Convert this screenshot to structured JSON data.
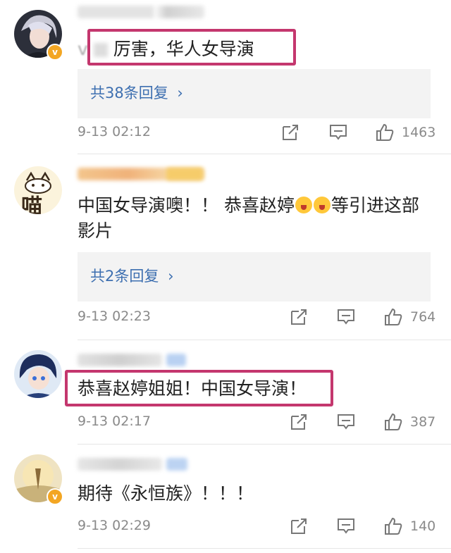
{
  "comments": [
    {
      "text": "厉害，华人女导演",
      "prefix": "v",
      "reply_label": "共38条回复",
      "time": "9-13 02:12",
      "likes": "1463"
    },
    {
      "text": "中国女导演噢！！ 恭喜赵婷",
      "text_tail": "等引进这部影片",
      "avatar_text": "喵",
      "reply_label": "共2条回复",
      "time": "9-13 02:23",
      "likes": "764"
    },
    {
      "text": "恭喜赵婷姐姐！中国女导演！",
      "time": "9-13 02:17",
      "likes": "387"
    },
    {
      "text": "期待《永恒族》！！！",
      "time": "9-13 02:29",
      "likes": "140"
    }
  ],
  "icons": {
    "share": "share-icon",
    "comment": "comment-icon",
    "like": "thumbs-up-icon",
    "verified": "verified-badge-icon"
  },
  "colors": {
    "highlight": "#c4376e",
    "link": "#3d6fb0",
    "verified": "#f3a623"
  }
}
